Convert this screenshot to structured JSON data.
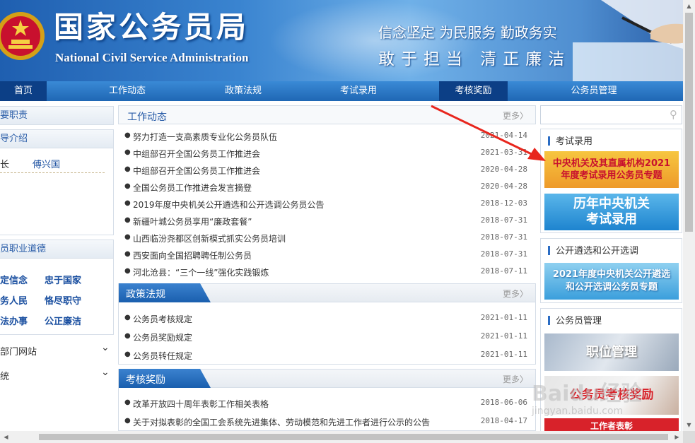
{
  "header": {
    "title": "国家公务员局",
    "title_en": "National Civil Service Administration",
    "slogan_line1": "信念坚定 为民服务 勤政务实",
    "slogan_line2": "敢于担当  清正廉洁"
  },
  "nav": {
    "items": [
      "首页",
      "工作动态",
      "政策法规",
      "考试录用",
      "考核奖励",
      "公务员管理"
    ]
  },
  "left": {
    "duties_title": "要职责",
    "leaders_title": "导介绍",
    "leaders_role": "长",
    "leaders_name": "傅兴国",
    "ethics_title": "员职业道德",
    "ethics": [
      "定信念",
      "忠于国家",
      "务人民",
      "恪尽职守",
      "法办事",
      "公正廉洁"
    ],
    "links1": "部门网站",
    "links2": "统"
  },
  "center": {
    "more_label": "更多〉",
    "work_news": {
      "title": "工作动态",
      "items": [
        {
          "text": "努力打造一支高素质专业化公务员队伍",
          "date": "2021-04-14"
        },
        {
          "text": "中组部召开全国公务员工作推进会",
          "date": "2021-03-31"
        },
        {
          "text": "中组部召开全国公务员工作推进会",
          "date": "2020-04-28"
        },
        {
          "text": "全国公务员工作推进会发言摘登",
          "date": "2020-04-28"
        },
        {
          "text": "2019年度中央机关公开遴选和公开选调公务员公告",
          "date": "2018-12-03"
        },
        {
          "text": "新疆叶城公务员享用“廉政套餐”",
          "date": "2018-07-31"
        },
        {
          "text": "山西临汾尧都区创新模式抓实公务员培训",
          "date": "2018-07-31"
        },
        {
          "text": "西安面向全国招聘聘任制公务员",
          "date": "2018-07-31"
        },
        {
          "text": "河北沧县：“三个一线”强化实践锻炼",
          "date": "2018-07-11"
        }
      ]
    },
    "policy": {
      "title": "政策法规",
      "items": [
        {
          "text": "公务员考核规定",
          "date": "2021-01-11"
        },
        {
          "text": "公务员奖励规定",
          "date": "2021-01-11"
        },
        {
          "text": "公务员转任规定",
          "date": "2021-01-11"
        }
      ]
    },
    "assessment": {
      "title": "考核奖励",
      "items": [
        {
          "text": "改革开放四十周年表彰工作相关表格",
          "date": "2018-06-06"
        },
        {
          "text": "关于对拟表彰的全国工会系统先进集体、劳动模范和先进工作者进行公示的公告",
          "date": "2018-04-17"
        }
      ]
    }
  },
  "right": {
    "search_placeholder": "",
    "exam_title": "考试录用",
    "banner1_line1": "中央机关及其直属机构2021",
    "banner1_line2": "年度考试录用公务员专题",
    "banner2_line1": "历年中央机关",
    "banner2_line2": "考试录用",
    "selection_title": "公开遴选和公开选调",
    "banner3_line1": "2021年度中央机关公开遴选",
    "banner3_line2": "和公开选调公务员专题",
    "mgmt_title": "公务员管理",
    "banner4": "职位管理",
    "banner5": "公务员考核奖励",
    "banner6": "工作者表彰"
  },
  "watermark": "Baidu经验",
  "watermark_url": "jingyan.baidu.com",
  "colors": {
    "nav": "#1f67b4",
    "nav_active": "#0c3f86",
    "accent_text": "#2a5da8",
    "arrow": "#e8261d"
  },
  "icons": [
    "emblem-icon",
    "search-icon",
    "chevron-down-icon",
    "red-arrow"
  ]
}
